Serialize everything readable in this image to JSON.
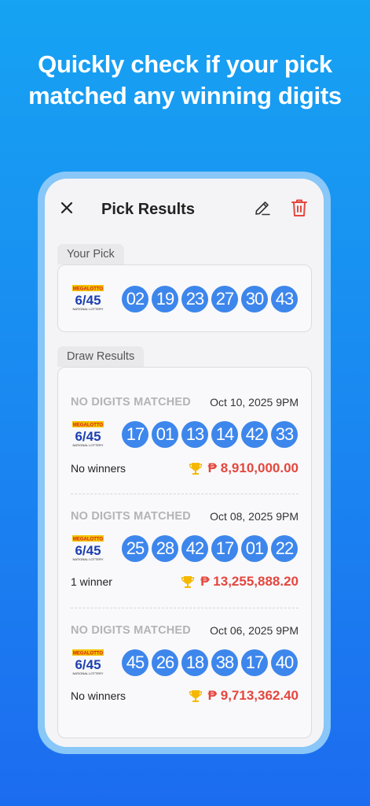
{
  "headline": {
    "line1": "Quickly check if your pick",
    "line2": "matched any winning digits"
  },
  "app": {
    "title": "Pick Results",
    "icons": [
      "close-icon",
      "edit-icon",
      "trash-icon"
    ]
  },
  "your_pick": {
    "label": "Your Pick",
    "logo": {
      "top": "MEGALOTTO",
      "main": "6/45",
      "bottom": "NATIONAL LOTTERY"
    },
    "numbers": [
      "02",
      "19",
      "23",
      "27",
      "30",
      "43"
    ]
  },
  "draw_results": {
    "label": "Draw Results",
    "items": [
      {
        "match": "NO DIGITS MATCHED",
        "date": "Oct 10, 2025 9PM",
        "numbers": [
          "17",
          "01",
          "13",
          "14",
          "42",
          "33"
        ],
        "winners": "No winners",
        "prize": "₱ 8,910,000.00"
      },
      {
        "match": "NO DIGITS MATCHED",
        "date": "Oct 08, 2025 9PM",
        "numbers": [
          "25",
          "28",
          "42",
          "17",
          "01",
          "22"
        ],
        "winners": "1 winner",
        "prize": "₱ 13,255,888.20"
      },
      {
        "match": "NO DIGITS MATCHED",
        "date": "Oct 06, 2025 9PM",
        "numbers": [
          "45",
          "26",
          "18",
          "38",
          "17",
          "40"
        ],
        "winners": "No winners",
        "prize": "₱ 9,713,362.40"
      }
    ]
  },
  "colors": {
    "ball": "#3d86ec",
    "prize": "#e4463e",
    "trash": "#e4463e",
    "trophy": "#f5b800"
  }
}
